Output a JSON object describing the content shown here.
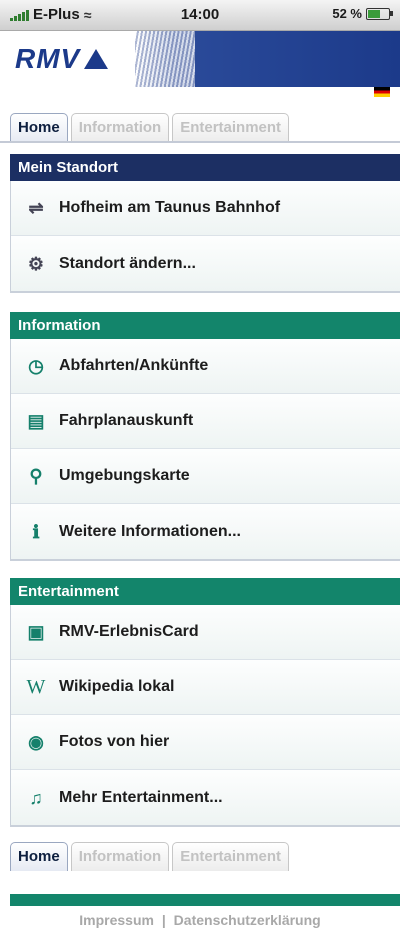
{
  "status_bar": {
    "carrier": "E-Plus",
    "time": "14:00",
    "battery": "52 %"
  },
  "header": {
    "logo_text": "RMV",
    "language_flag": "german-flag-icon"
  },
  "tabs_top": [
    {
      "label": "Home",
      "active": true
    },
    {
      "label": "Information",
      "active": false
    },
    {
      "label": "Entertainment",
      "active": false
    }
  ],
  "sections": {
    "standort": {
      "title": "Mein Standort",
      "items": [
        {
          "label": "Hofheim am Taunus Bahnhof",
          "icon": "transfer-icon"
        },
        {
          "label": "Standort ändern...",
          "icon": "location-change-icon"
        }
      ]
    },
    "information": {
      "title": "Information",
      "items": [
        {
          "label": "Abfahrten/Ankünfte",
          "icon": "departures-icon"
        },
        {
          "label": "Fahrplanauskunft",
          "icon": "timetable-icon"
        },
        {
          "label": "Umgebungskarte",
          "icon": "magnifier-icon"
        },
        {
          "label": "Weitere Informationen...",
          "icon": "more-info-icon"
        }
      ]
    },
    "entertainment": {
      "title": "Entertainment",
      "items": [
        {
          "label": "RMV-ErlebnisCard",
          "icon": "card-icon"
        },
        {
          "label": "Wikipedia lokal",
          "icon": "wikipedia-icon"
        },
        {
          "label": "Fotos von hier",
          "icon": "camera-icon"
        },
        {
          "label": "Mehr Entertainment...",
          "icon": "music-icon"
        }
      ]
    }
  },
  "tabs_bottom": [
    {
      "label": "Home",
      "active": true
    },
    {
      "label": "Information",
      "active": false
    },
    {
      "label": "Entertainment",
      "active": false
    }
  ],
  "footer": {
    "impressum": "Impressum",
    "separator": "|",
    "datenschutz": "Datenschutzerklärung"
  },
  "colors": {
    "navy": "#1c2f63",
    "green": "#13856b",
    "inactive_tab_text": "#c2c2c2"
  }
}
